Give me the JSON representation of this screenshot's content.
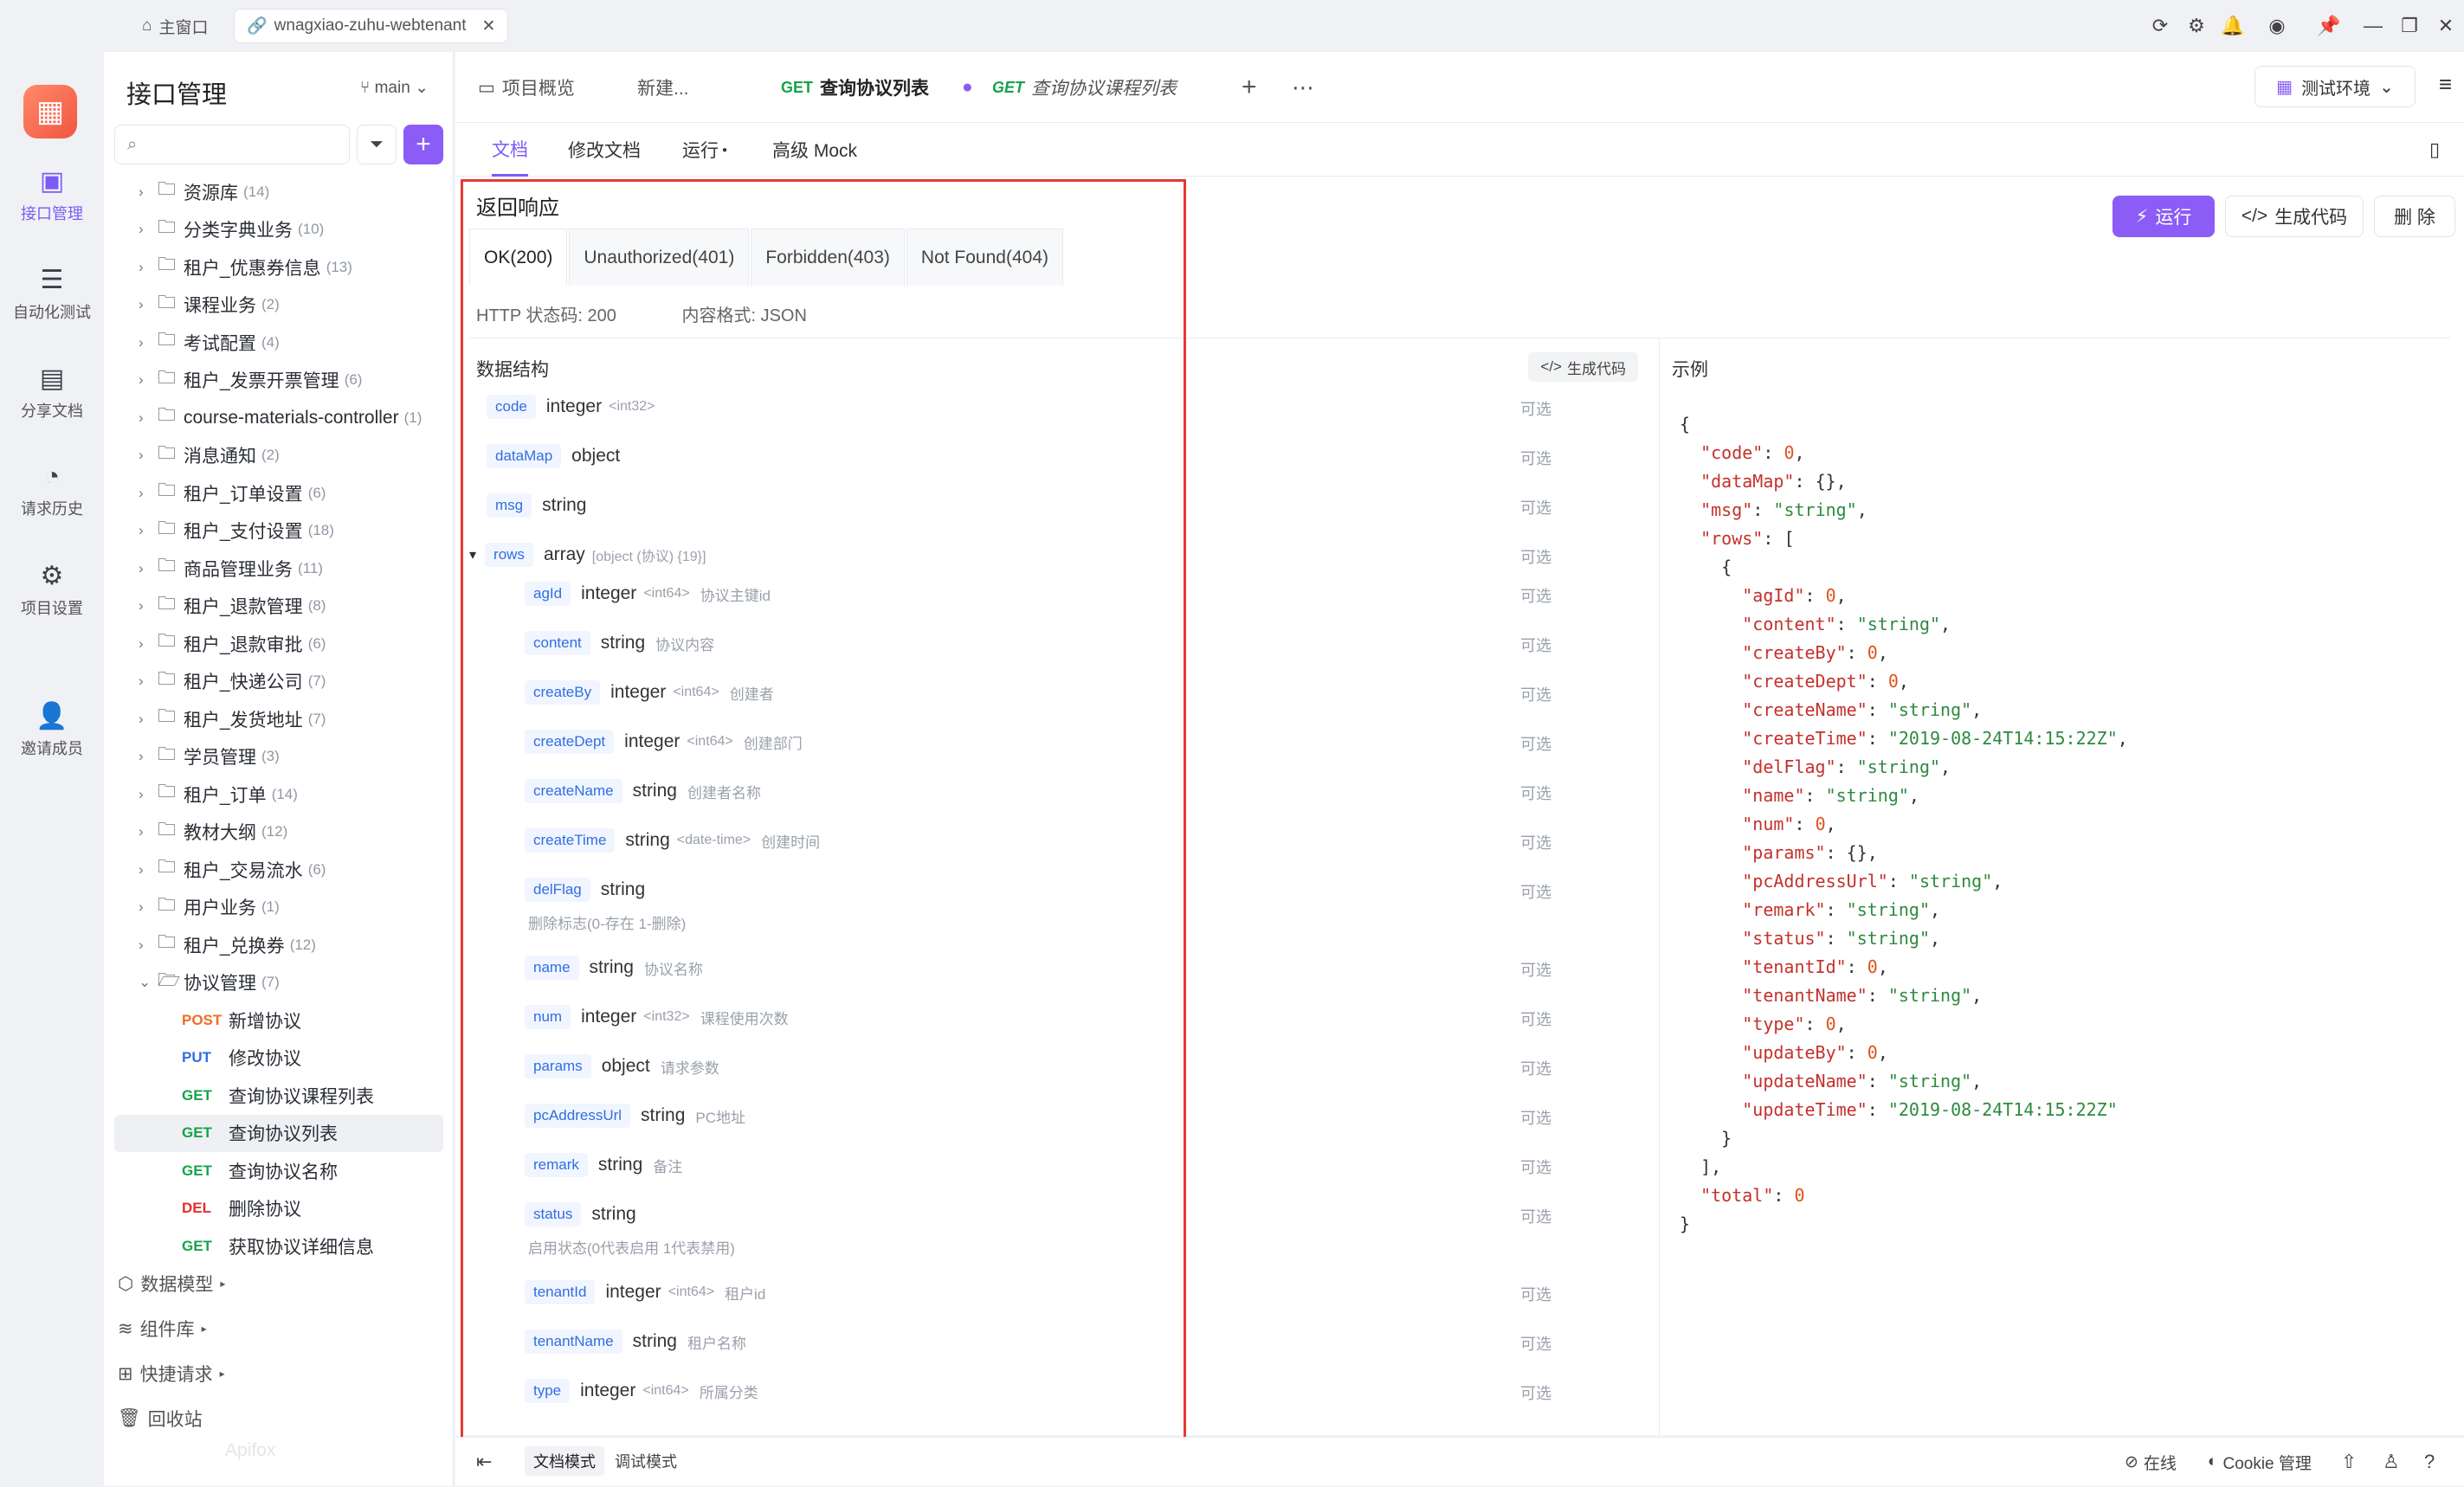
{
  "window": {
    "tabs": [
      {
        "label": "主窗口"
      },
      {
        "label": "wnagxiao-zuhu-webtenant"
      }
    ]
  },
  "nav": {
    "items": [
      {
        "label": "接口管理",
        "icon": "api-icon"
      },
      {
        "label": "自动化测试",
        "icon": "auto-test-icon"
      },
      {
        "label": "分享文档",
        "icon": "share-doc-icon"
      },
      {
        "label": "请求历史",
        "icon": "history-icon"
      },
      {
        "label": "项目设置",
        "icon": "settings-icon"
      },
      {
        "label": "邀请成员",
        "icon": "invite-icon"
      }
    ]
  },
  "sidebar": {
    "title": "接口管理",
    "branch": "main",
    "folders": [
      {
        "name": "资源库",
        "count": "(14)"
      },
      {
        "name": "分类字典业务",
        "count": "(10)"
      },
      {
        "name": "租户_优惠券信息",
        "count": "(13)"
      },
      {
        "name": "课程业务",
        "count": "(2)"
      },
      {
        "name": "考试配置",
        "count": "(4)"
      },
      {
        "name": "租户_发票开票管理",
        "count": "(6)"
      },
      {
        "name": "course-materials-controller",
        "count": "(1)"
      },
      {
        "name": "消息通知",
        "count": "(2)"
      },
      {
        "name": "租户_订单设置",
        "count": "(6)"
      },
      {
        "name": "租户_支付设置",
        "count": "(18)"
      },
      {
        "name": "商品管理业务",
        "count": "(11)"
      },
      {
        "name": "租户_退款管理",
        "count": "(8)"
      },
      {
        "name": "租户_退款审批",
        "count": "(6)"
      },
      {
        "name": "租户_快递公司",
        "count": "(7)"
      },
      {
        "name": "租户_发货地址",
        "count": "(7)"
      },
      {
        "name": "学员管理",
        "count": "(3)"
      },
      {
        "name": "租户_订单",
        "count": "(14)"
      },
      {
        "name": "教材大纲",
        "count": "(12)"
      },
      {
        "name": "租户_交易流水",
        "count": "(6)"
      },
      {
        "name": "用户业务",
        "count": "(1)"
      },
      {
        "name": "租户_兑换券",
        "count": "(12)"
      }
    ],
    "open_folder": {
      "name": "协议管理",
      "count": "(7)"
    },
    "apis": [
      {
        "method": "POST",
        "name": "新增协议",
        "cls": "m-post"
      },
      {
        "method": "PUT",
        "name": "修改协议",
        "cls": "m-put"
      },
      {
        "method": "GET",
        "name": "查询协议课程列表",
        "cls": "m-get"
      },
      {
        "method": "GET",
        "name": "查询协议列表",
        "cls": "m-get"
      },
      {
        "method": "GET",
        "name": "查询协议名称",
        "cls": "m-get"
      },
      {
        "method": "DEL",
        "name": "删除协议",
        "cls": "m-del"
      },
      {
        "method": "GET",
        "name": "获取协议详细信息",
        "cls": "m-get"
      }
    ],
    "footer": [
      "数据模型",
      "组件库",
      "快捷请求",
      "回收站"
    ],
    "watermark": "Apifox"
  },
  "topbar": {
    "tabs": [
      {
        "label": "项目概览"
      },
      {
        "label": "新建..."
      },
      {
        "method": "GET",
        "label": "查询协议列表"
      },
      {
        "method": "GET",
        "label": "查询协议课程列表"
      }
    ],
    "env": "测试环境"
  },
  "subtabs": [
    "文档",
    "修改文档",
    "运行",
    "高级 Mock"
  ],
  "buttons": {
    "run": "运行",
    "gen": "生成代码",
    "del": "删 除"
  },
  "response": {
    "title": "返回响应",
    "tabs": [
      "OK(200)",
      "Unauthorized(401)",
      "Forbidden(403)",
      "Not Found(404)"
    ],
    "status": "HTTP 状态码: 200",
    "format": "内容格式: JSON",
    "schema_title": "数据结构",
    "gen_code": "生成代码",
    "example_title": "示例",
    "optional": "可选",
    "fields": [
      {
        "name": "code",
        "type": "integer",
        "fmt": "<int32>",
        "desc": ""
      },
      {
        "name": "dataMap",
        "type": "object",
        "fmt": "",
        "desc": ""
      },
      {
        "name": "msg",
        "type": "string",
        "fmt": "",
        "desc": ""
      },
      {
        "name": "rows",
        "type": "array",
        "fmt": "[object (协议) {19}]",
        "desc": ""
      }
    ],
    "row_fields": [
      {
        "name": "agId",
        "type": "integer",
        "fmt": "<int64>",
        "desc": "协议主键id",
        "sub": ""
      },
      {
        "name": "content",
        "type": "string",
        "fmt": "",
        "desc": "协议内容",
        "sub": ""
      },
      {
        "name": "createBy",
        "type": "integer",
        "fmt": "<int64>",
        "desc": "创建者",
        "sub": ""
      },
      {
        "name": "createDept",
        "type": "integer",
        "fmt": "<int64>",
        "desc": "创建部门",
        "sub": ""
      },
      {
        "name": "createName",
        "type": "string",
        "fmt": "",
        "desc": "创建者名称",
        "sub": ""
      },
      {
        "name": "createTime",
        "type": "string",
        "fmt": "<date-time>",
        "desc": "创建时间",
        "sub": ""
      },
      {
        "name": "delFlag",
        "type": "string",
        "fmt": "",
        "desc": "",
        "sub": "删除标志(0-存在 1-删除)"
      },
      {
        "name": "name",
        "type": "string",
        "fmt": "",
        "desc": "协议名称",
        "sub": ""
      },
      {
        "name": "num",
        "type": "integer",
        "fmt": "<int32>",
        "desc": "课程使用次数",
        "sub": ""
      },
      {
        "name": "params",
        "type": "object",
        "fmt": "",
        "desc": "请求参数",
        "sub": ""
      },
      {
        "name": "pcAddressUrl",
        "type": "string",
        "fmt": "",
        "desc": "PC地址",
        "sub": ""
      },
      {
        "name": "remark",
        "type": "string",
        "fmt": "",
        "desc": "备注",
        "sub": ""
      },
      {
        "name": "status",
        "type": "string",
        "fmt": "",
        "desc": "",
        "sub": "启用状态(0代表启用 1代表禁用)"
      },
      {
        "name": "tenantId",
        "type": "integer",
        "fmt": "<int64>",
        "desc": "租户id",
        "sub": ""
      },
      {
        "name": "tenantName",
        "type": "string",
        "fmt": "",
        "desc": "租户名称",
        "sub": ""
      },
      {
        "name": "type",
        "type": "integer",
        "fmt": "<int64>",
        "desc": "所属分类",
        "sub": ""
      }
    ],
    "example_lines": [
      "{",
      "  \"code\": 0,",
      "  \"dataMap\": {},",
      "  \"msg\": \"string\",",
      "  \"rows\": [",
      "    {",
      "      \"agId\": 0,",
      "      \"content\": \"string\",",
      "      \"createBy\": 0,",
      "      \"createDept\": 0,",
      "      \"createName\": \"string\",",
      "      \"createTime\": \"2019-08-24T14:15:22Z\",",
      "      \"delFlag\": \"string\",",
      "      \"name\": \"string\",",
      "      \"num\": 0,",
      "      \"params\": {},",
      "      \"pcAddressUrl\": \"string\",",
      "      \"remark\": \"string\",",
      "      \"status\": \"string\",",
      "      \"tenantId\": 0,",
      "      \"tenantName\": \"string\",",
      "      \"type\": 0,",
      "      \"updateBy\": 0,",
      "      \"updateName\": \"string\",",
      "      \"updateTime\": \"2019-08-24T14:15:22Z\"",
      "    }",
      "  ],",
      "  \"total\": 0",
      "}"
    ]
  },
  "bottombar": {
    "doc_mode": "文档模式",
    "debug_mode": "调试模式",
    "online": "在线",
    "cookie": "Cookie 管理"
  },
  "colors": {
    "accent": "#8b5cf6",
    "get": "#17a34a",
    "post": "#f26d21",
    "put": "#2f6fe0",
    "del": "#e0302f",
    "highlight": "#e53935"
  }
}
